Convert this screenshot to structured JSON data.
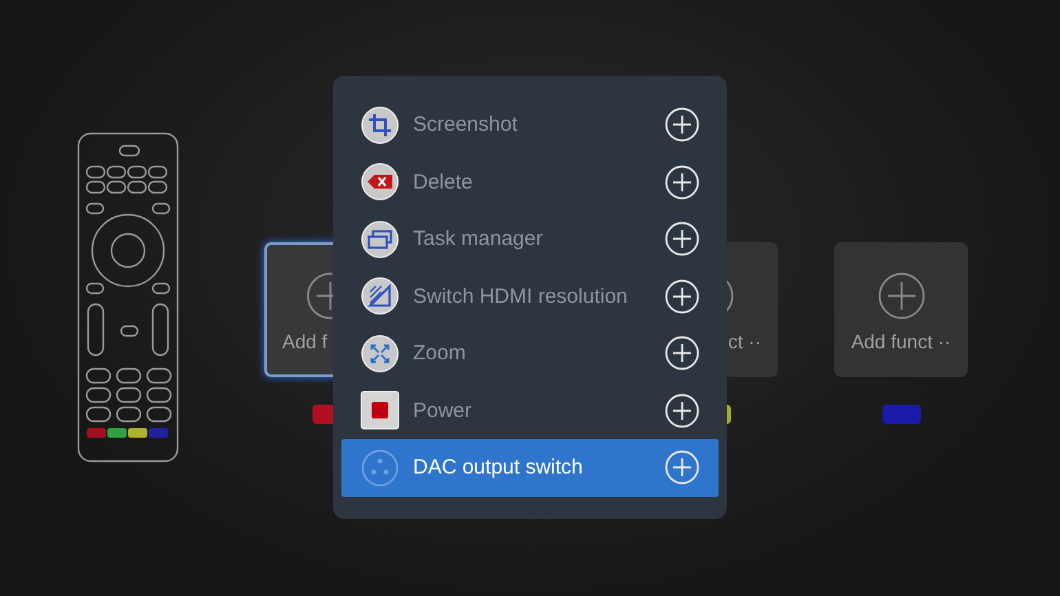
{
  "cards": [
    {
      "label": "Add f",
      "selected": true,
      "color": "#b01020"
    },
    {
      "label": "ct ··",
      "selected": false,
      "color": "#a8b020"
    },
    {
      "label": "Add funct ··",
      "selected": false,
      "color": "#1a1aa8"
    }
  ],
  "menu": {
    "items": [
      {
        "kind": "crop",
        "label": "Screenshot",
        "selected": false
      },
      {
        "kind": "delete",
        "label": "Delete",
        "selected": false
      },
      {
        "kind": "windows",
        "label": "Task manager",
        "selected": false
      },
      {
        "kind": "hdmi",
        "label": "Switch HDMI resolution",
        "selected": false
      },
      {
        "kind": "zoom",
        "label": "Zoom",
        "selected": false
      },
      {
        "kind": "power",
        "label": "Power",
        "selected": false
      },
      {
        "kind": "dac",
        "label": "DAC output switch",
        "selected": true
      }
    ]
  }
}
